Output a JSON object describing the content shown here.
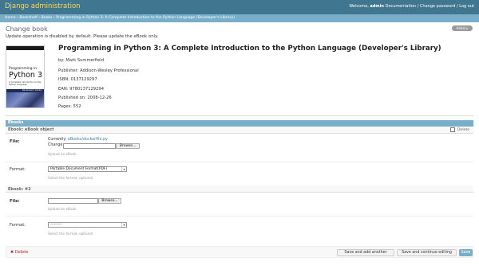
{
  "header": {
    "site_name": "Django administration",
    "welcome": "Welcome,",
    "username": "admin",
    "documentation": "Documentation",
    "change_password": "Change password",
    "logout": "Log out",
    "sep": "/"
  },
  "breadcrumbs": {
    "items": [
      "Home",
      "Bookshelf",
      "Books",
      "Programming in Python 3: A Complete Introduction to the Python Language (Developer's Library)"
    ],
    "sep": "›"
  },
  "page": {
    "title": "Change book",
    "history_label": "History",
    "notice": "Update operation is disabled by default. Please update the eBook only."
  },
  "cover": {
    "title_line": "Programming in",
    "big": "Python 3",
    "sub": "A Complete Introduction to the Python Language",
    "library": "Developer's Library"
  },
  "book": {
    "title": "Programming in Python 3: A Complete Introduction to the Python Language (Developer's Library)",
    "by": "by: Mark Summerfield",
    "publisher": "Publisher: Addison-Wesley Professional",
    "isbn": "ISBN: 0137129297",
    "ean": "EAN: 9780137129294",
    "published": "Published on: 2008-12-26",
    "pages": "Pages: 552"
  },
  "ebooks": {
    "header": "Ebooks",
    "object1_label": "Ebook: eBook object",
    "delete_label": "Delete",
    "file_label": "File:",
    "currently_label": "Currently:",
    "current_file": "eBooks/dockerfile.py",
    "change_label": "Change:",
    "browse_label": "Browse...",
    "upload_help": "Upload an eBook.",
    "format_label": "Format:",
    "format1_value": "Portable Document Format(PDF)",
    "format_help": "Select the format, optional",
    "object2_label": "Ebook: #2",
    "format2_value": "---------"
  },
  "submit": {
    "delete_label": "Delete",
    "save_add": "Save and add another",
    "save_continue": "Save and continue editing",
    "save": "Save"
  },
  "colors": {
    "header_bg": "#417690",
    "header_text": "#f5dd5d",
    "breadcrumb_bg": "#79aec8",
    "link": "#447e9b",
    "delete": "#ba2121"
  }
}
